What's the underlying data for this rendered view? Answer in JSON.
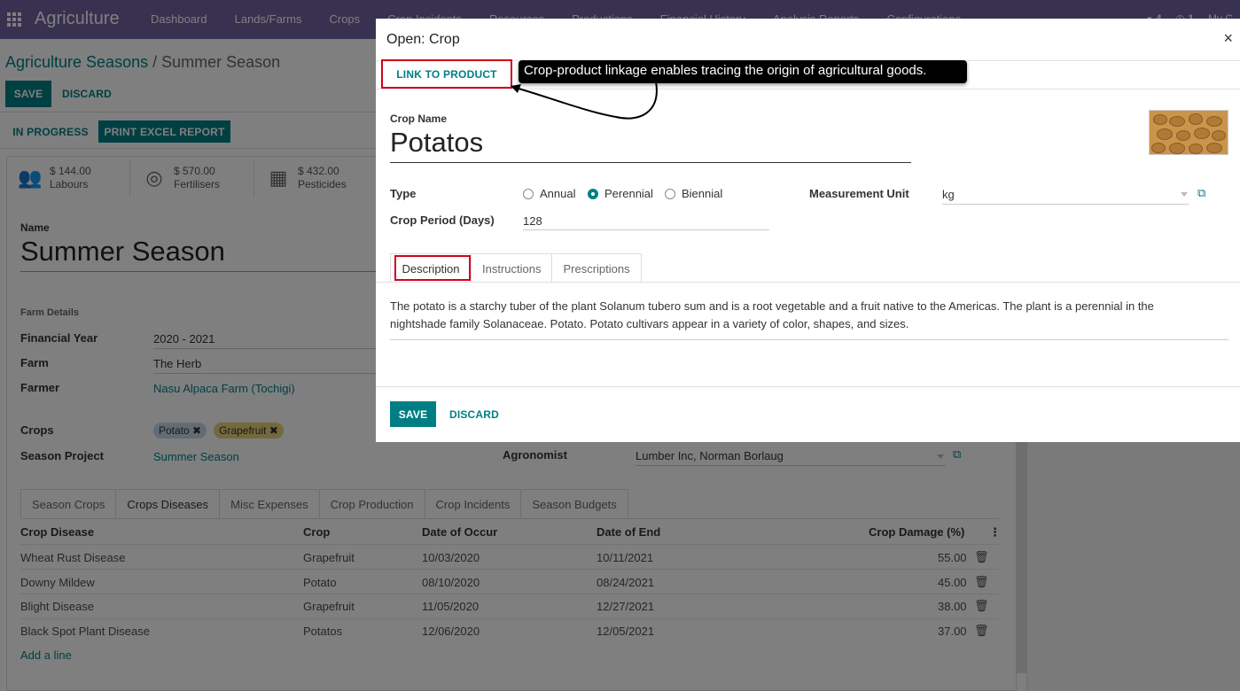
{
  "nav": {
    "brand": "Agriculture",
    "menu": [
      "Dashboard",
      "Lands/Farms",
      "Crops",
      "Crop Incidents",
      "Resources",
      "Productions",
      "Financial History",
      "Analysis Reports",
      "Configurations"
    ],
    "badge_chat": "4",
    "badge_activity": "1",
    "user": "My C"
  },
  "breadcrumb": {
    "parent": "Agriculture Seasons",
    "sep": " / ",
    "current": "Summer Season"
  },
  "actions": {
    "save": "SAVE",
    "discard": "DISCARD"
  },
  "status": {
    "in_progress": "IN PROGRESS",
    "print": "PRINT EXCEL REPORT"
  },
  "stats": [
    {
      "icon": "users-icon",
      "value": "$ 144.00",
      "label": "Labours"
    },
    {
      "icon": "lifebuoy-icon",
      "value": "$ 570.00",
      "label": "Fertilisers"
    },
    {
      "icon": "cubes-icon",
      "value": "$ 432.00",
      "label": "Pesticides"
    }
  ],
  "form": {
    "name_label": "Name",
    "name_value": "Summer Season",
    "farm_details": "Farm Details",
    "financial_year_label": "Financial Year",
    "financial_year": "2020 - 2021",
    "farm_label": "Farm",
    "farm": "The Herb",
    "farmer_label": "Farmer",
    "farmer": "Nasu Alpaca Farm (Tochigi)",
    "crops_label": "Crops",
    "crop_tags": [
      "Potato",
      "Grapefruit"
    ],
    "project_label": "Season Project",
    "project": "Summer Season",
    "agronomist_label": "Agronomist",
    "agronomist": "Lumber Inc, Norman Borlaug"
  },
  "season_tabs": [
    "Season Crops",
    "Crops Diseases",
    "Misc Expenses",
    "Crop Production",
    "Crop Incidents",
    "Season Budgets"
  ],
  "table": {
    "headers": [
      "Crop Disease",
      "Crop",
      "Date of Occur",
      "Date of End",
      "Crop Damage (%)"
    ],
    "rows": [
      [
        "Wheat Rust Disease",
        "Grapefruit",
        "10/03/2020",
        "10/11/2021",
        "55.00"
      ],
      [
        "Downy Mildew",
        "Potato",
        "08/10/2020",
        "08/24/2021",
        "45.00"
      ],
      [
        "Blight Disease",
        "Grapefruit",
        "11/05/2020",
        "12/27/2021",
        "38.00"
      ],
      [
        "Black Spot Plant Disease",
        "Potatos",
        "12/06/2020",
        "12/05/2021",
        "37.00"
      ]
    ],
    "add_line": "Add a line"
  },
  "modal": {
    "title": "Open: Crop",
    "close": "×",
    "link_to_product": "LINK TO PRODUCT",
    "callout": "Crop-product linkage enables tracing the origin of agricultural goods.",
    "crop_name_label": "Crop Name",
    "crop_name": "Potatos",
    "type_label": "Type",
    "type_options": [
      "Annual",
      "Perennial",
      "Biennial"
    ],
    "type_selected": "Perennial",
    "period_label": "Crop Period (Days)",
    "period": "128",
    "uom_label": "Measurement Unit",
    "uom": "kg",
    "tabs": [
      "Description",
      "Instructions",
      "Prescriptions"
    ],
    "description": "The potato is a starchy tuber of the plant Solanum tubero sum and is a root vegetable and a fruit native to the Americas. The plant is a perennial in the nightshade family Solanaceae. Potato. Potato cultivars appear in a variety of color, shapes, and sizes.",
    "save": "SAVE",
    "discard": "DISCARD"
  },
  "colors": {
    "primary": "#017e84",
    "nav": "#71639e",
    "highlight": "#d0021b"
  }
}
